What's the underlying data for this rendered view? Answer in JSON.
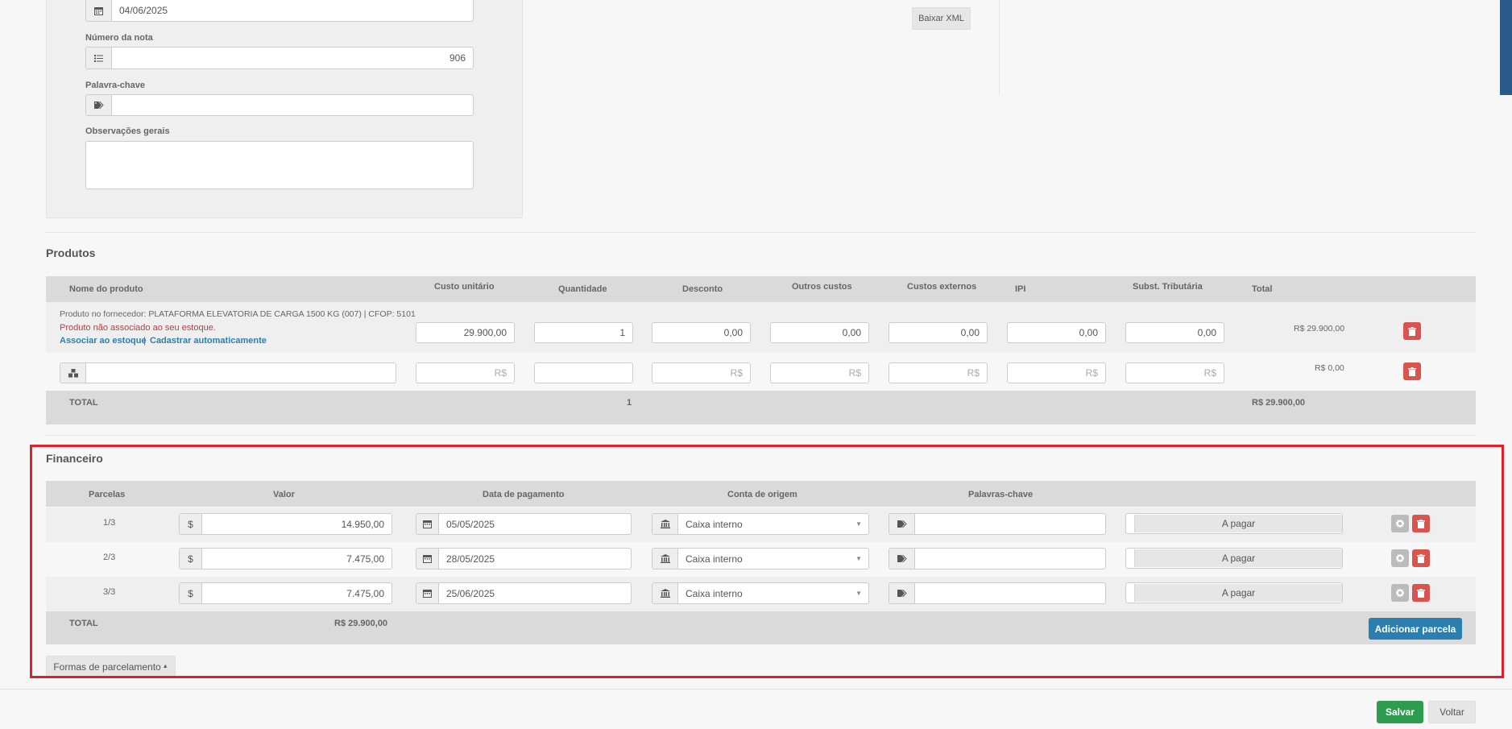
{
  "form": {
    "date_value": "04/06/2025",
    "note_number_label": "Número da nota",
    "note_number_value": "906",
    "keyword_label": "Palavra-chave",
    "observations_label": "Observações gerais",
    "download_xml": "Baixar XML"
  },
  "produtos": {
    "title": "Produtos",
    "headers": {
      "name": "Nome do produto",
      "unit_cost": "Custo unitário",
      "quantity": "Quantidade",
      "discount": "Desconto",
      "other_costs": "Outros custos",
      "external_costs": "Custos externos",
      "ipi": "IPI",
      "st": "Subst. Tributária",
      "total": "Total"
    },
    "item": {
      "supplier_text": "Produto no fornecedor: PLATAFORMA ELEVATORIA DE CARGA 1500 KG (007) | CFOP: 5101",
      "warning": "Produto não associado ao seu estoque.",
      "link_associate": "Associar ao estoque",
      "separator": "|",
      "link_register": "Cadastrar automaticamente",
      "unit_cost": "29.900,00",
      "quantity": "1",
      "discount": "0,00",
      "other_costs": "0,00",
      "external_costs": "0,00",
      "ipi": "0,00",
      "st": "0,00",
      "total": "R$ 29.900,00"
    },
    "new_row": {
      "currency_placeholder": "R$",
      "total": "R$ 0,00"
    },
    "footer": {
      "label": "TOTAL",
      "quantity": "1",
      "total": "R$ 29.900,00"
    }
  },
  "financeiro": {
    "title": "Financeiro",
    "headers": {
      "parcelas": "Parcelas",
      "valor": "Valor",
      "data": "Data de pagamento",
      "conta": "Conta de origem",
      "palavras": "Palavras-chave"
    },
    "currency_symbol": "$",
    "rows": [
      {
        "parcela": "1/3",
        "valor": "14.950,00",
        "data": "05/05/2025",
        "conta": "Caixa interno",
        "status": "A pagar"
      },
      {
        "parcela": "2/3",
        "valor": "7.475,00",
        "data": "28/05/2025",
        "conta": "Caixa interno",
        "status": "A pagar"
      },
      {
        "parcela": "3/3",
        "valor": "7.475,00",
        "data": "25/06/2025",
        "conta": "Caixa interno",
        "status": "A pagar"
      }
    ],
    "footer": {
      "label": "TOTAL",
      "total": "R$ 29.900,00",
      "add_button": "Adicionar parcela"
    },
    "installment_forms": "Formas de parcelamento"
  },
  "actions": {
    "save": "Salvar",
    "back": "Voltar"
  },
  "colors": {
    "accent_blue": "#2a7fb0",
    "danger": "#d9534f",
    "success": "#2e9c4f",
    "highlight_border": "#e0202a"
  }
}
